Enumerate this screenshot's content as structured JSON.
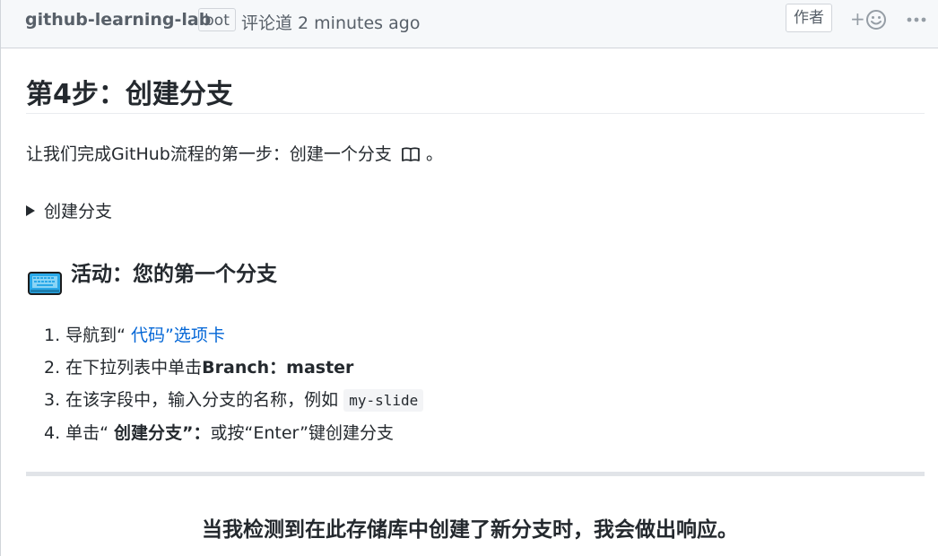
{
  "header": {
    "author": "github-learning-lab",
    "bot_label": "bot",
    "timestamp": "评论道 2 minutes ago",
    "author_badge": "作者",
    "reaction_plus": "+",
    "icons": [
      "smiley-icon",
      "kebab-icon"
    ]
  },
  "content": {
    "title": "第4步：创建分支",
    "intro": "让我们完成GitHub流程的第一步：创建一个分支",
    "intro_end": "。",
    "details_summary": "创建分支",
    "activity_title": "活动：您的第一个分支",
    "steps": [
      {
        "num": "1.",
        "prefix": "导航到“ ",
        "link": "代码”选项卡"
      },
      {
        "num": "2.",
        "prefix": "在下拉列表中单击",
        "strong": "Branch：master"
      },
      {
        "num": "3.",
        "prefix": "在该字段中，输入分支的名称，例如 ",
        "code": "my-slide"
      },
      {
        "num": "4.",
        "prefix": "单击“ ",
        "strong": "创建分支”：",
        "suffix": "或按“Enter”键创建分支"
      }
    ],
    "final_note": "当我检测到在此存储库中创建了新分支时，我会做出响应。"
  },
  "colors": {
    "link": "#0366d6",
    "header_bg": "#f6f8fa",
    "muted": "#586069",
    "keyboard": "#29a8e8"
  }
}
